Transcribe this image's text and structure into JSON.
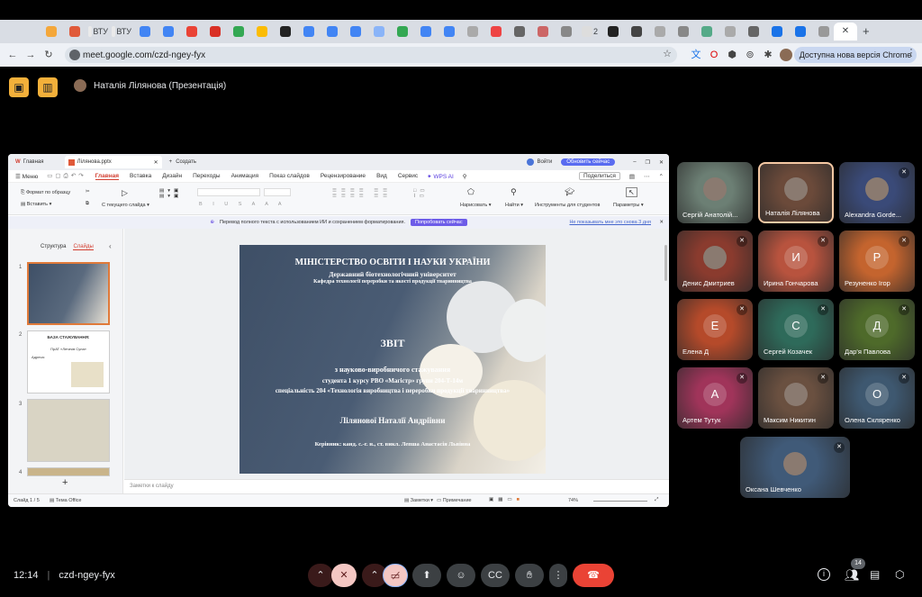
{
  "browser": {
    "tabs": [
      "",
      "",
      "ВТУ",
      "ВТУ",
      "",
      "",
      "",
      "",
      "",
      "",
      "",
      "",
      "",
      "",
      "",
      "",
      "",
      "",
      "",
      "",
      "",
      "",
      "",
      "2",
      "",
      "",
      "",
      "",
      "",
      "",
      "",
      "",
      "",
      ""
    ],
    "url": "meet.google.com/czd-ngey-fyx",
    "update_label": "Доступна нова версія Chrome"
  },
  "meet": {
    "presenter": "Наталія Лілянова (Презентація)",
    "time": "12:14",
    "meeting_code": "czd-ngey-fyx",
    "participants_count": "14"
  },
  "wps": {
    "home_tab": "Главная",
    "file_tab": "Лілянова.pptx",
    "new_tab": "Создать",
    "login": "Войти",
    "upgrade": "Обновить сейчас",
    "menu": "Меню",
    "ribbon_tabs": [
      "Главная",
      "Вставка",
      "Дизайн",
      "Переходы",
      "Анимация",
      "Показ слайдов",
      "Рецензирование",
      "Вид",
      "Сервис"
    ],
    "wps_ai": "WPS AI",
    "share": "Поделиться",
    "format_painter": "Формат по образцу",
    "paste": "Вставить",
    "from_current": "С текущего слайда",
    "draw_shapes": "Нарисовать",
    "find": "Найти",
    "tools_students": "Инструменты для студентов",
    "params": "Параметры",
    "notice": "Перевод полного текста с использованием ИИ и сохранением форматирования.",
    "notice_btn": "Попробовать сейчас",
    "notice_hide": "Не показывать мне это снова 3 дня",
    "panel_structure": "Структура",
    "panel_slides": "Слайды",
    "slide_numbers": [
      "1",
      "2",
      "3",
      "4"
    ],
    "notes_placeholder": "Заметки к слайду",
    "status_slide": "Слайд 1 / 5",
    "status_theme": "Тема Office",
    "status_notes": "Заметки",
    "status_comment": "Примечание",
    "zoom": "74%"
  },
  "thumbs": {
    "t2_title": "БАЗА СТАЖУВАННЯ:",
    "t2_sub": "ПрАТ «Летичів Сула»",
    "t2_addr": "Адреса:"
  },
  "slide": {
    "ministry": "МІНІСТЕРСТВО ОСВІТИ І НАУКИ УКРАЇНИ",
    "university": "Державний біотехнологічний університет",
    "department": "Кафедра технології переробки та якості продукції тваринництва",
    "report": "ЗВІТ",
    "line1": "з науково-виробничого стажування",
    "line2": "студента 1 курсу РВО «Магістр» групи 204-Т-14м",
    "line3": "спеціальність 204 «Технологія виробництва і переробки продукції тваринництва»",
    "student": "Лілянової  Наталії Андріївни",
    "supervisor": "Керівник: канд. с.-г. н., ст. викл. Лепша Анастасія Львівна"
  },
  "participants": [
    {
      "name": "Сергій Анатолій...",
      "initial": "",
      "color": "#6c7f74"
    },
    {
      "name": "Наталія Лілянова",
      "initial": "",
      "color": "#6b4a3a"
    },
    {
      "name": "Alexandra Gorde...",
      "initial": "",
      "color": "#3a4a78"
    },
    {
      "name": "Денис Дмитриев",
      "initial": "",
      "color": "#8a3b2e"
    },
    {
      "name": "Ирина Гончарова",
      "initial": "И",
      "color": "#b8533e"
    },
    {
      "name": "Резуненко Ігор",
      "initial": "Р",
      "color": "#c4642e"
    },
    {
      "name": "Елена Д",
      "initial": "Е",
      "color": "#b54a2a"
    },
    {
      "name": "Сергей Козачек",
      "initial": "С",
      "color": "#2e6a5a"
    },
    {
      "name": "Дар'я Павлова",
      "initial": "Д",
      "color": "#4e6a2a"
    },
    {
      "name": "Артем Тутук",
      "initial": "А",
      "color": "#a0345a"
    },
    {
      "name": "Максим Никитин",
      "initial": "",
      "color": "#6a5040"
    },
    {
      "name": "Олена Скляренко",
      "initial": "О",
      "color": "#3e5870"
    },
    {
      "name": "Оксана Шевченко",
      "initial": "",
      "color": "#405a78"
    }
  ]
}
